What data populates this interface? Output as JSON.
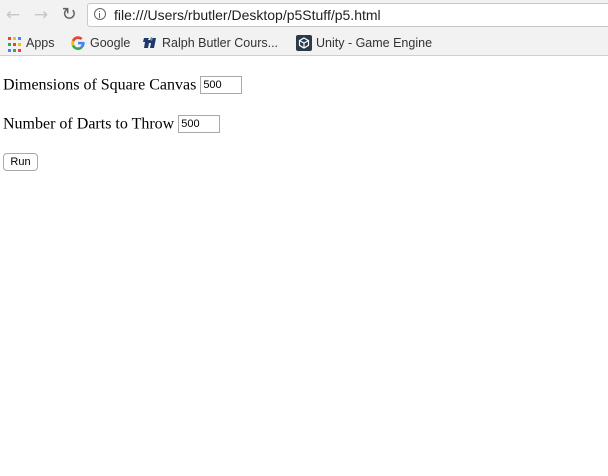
{
  "browser": {
    "url": "file:///Users/rbutler/Desktop/p5Stuff/p5.html",
    "nav": {
      "back_icon": "←",
      "forward_icon": "→",
      "reload_icon": "↻"
    },
    "bookmarks": [
      {
        "label": "Apps",
        "icon": "apps-grid-icon"
      },
      {
        "label": "Google",
        "icon": "google-icon"
      },
      {
        "label": "Ralph Butler Cours...",
        "icon": "university-logo-icon"
      },
      {
        "label": "Unity - Game Engine",
        "icon": "unity-icon"
      }
    ]
  },
  "form": {
    "canvas_label": "Dimensions of Square Canvas",
    "canvas_value": "500",
    "darts_label": "Number of Darts to Throw",
    "darts_value": "500",
    "run_label": "Run"
  },
  "colors": {
    "toolbar_bg": "#f2f2f2",
    "apps_grid": [
      "#ea4335",
      "#fbbc05",
      "#4285f4",
      "#34a853",
      "#ea4335",
      "#fbbc05",
      "#4285f4",
      "#34a853",
      "#ea4335"
    ],
    "unity_icon_bg": "#2b3a4a"
  }
}
